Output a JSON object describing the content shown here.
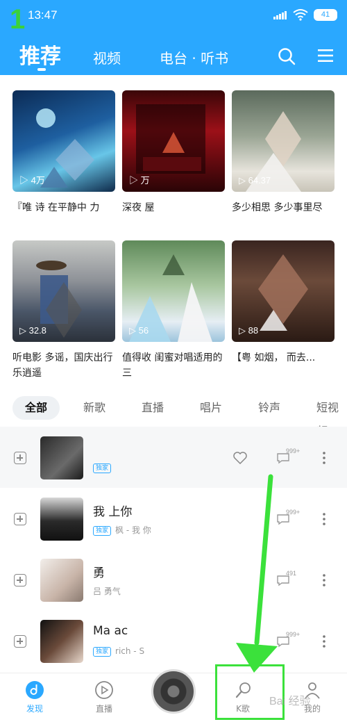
{
  "status_bar": {
    "time": "13:47",
    "battery": "41",
    "step_number": "1"
  },
  "header": {
    "tabs": [
      {
        "label": "推荐"
      },
      {
        "label": "视频"
      },
      {
        "label": "电台 · 听书"
      }
    ]
  },
  "playlists": [
    {
      "play_count": "4万",
      "title": "『唯 诗 在平静中 力"
    },
    {
      "play_count": "万",
      "title": "深夜 屋"
    },
    {
      "play_count": "64.37",
      "title": "多少相思 多少事里尽"
    },
    {
      "play_count": "32.8",
      "title": "听电影 多谣，国庆出行乐逍遥"
    },
    {
      "play_count": "56",
      "title": "值得收 闺蜜对唱适用的三"
    },
    {
      "play_count": "88",
      "title": "【粤 如烟， 而去..."
    }
  ],
  "categories": [
    "全部",
    "新歌",
    "直播",
    "唱片",
    "铃声",
    "短视频"
  ],
  "songs": [
    {
      "name": "",
      "tag": "独家",
      "sub": "",
      "comment_count": "999+"
    },
    {
      "name": "我 上你",
      "tag": "独家",
      "sub": "枫 - 我 你",
      "comment_count": "999+"
    },
    {
      "name": "勇",
      "tag": "",
      "sub": "吕 勇气",
      "comment_count": "491"
    },
    {
      "name": "Ma ac",
      "tag": "独家",
      "sub": "rich - S",
      "comment_count": "999+"
    }
  ],
  "bottom_nav": {
    "items": [
      {
        "label": "发现"
      },
      {
        "label": "直播"
      },
      {
        "label": "K歌"
      },
      {
        "label": "我的"
      }
    ]
  },
  "colors": {
    "accent": "#2aa8ff",
    "annotation": "#3be13b"
  },
  "watermark": "Bai 经验"
}
